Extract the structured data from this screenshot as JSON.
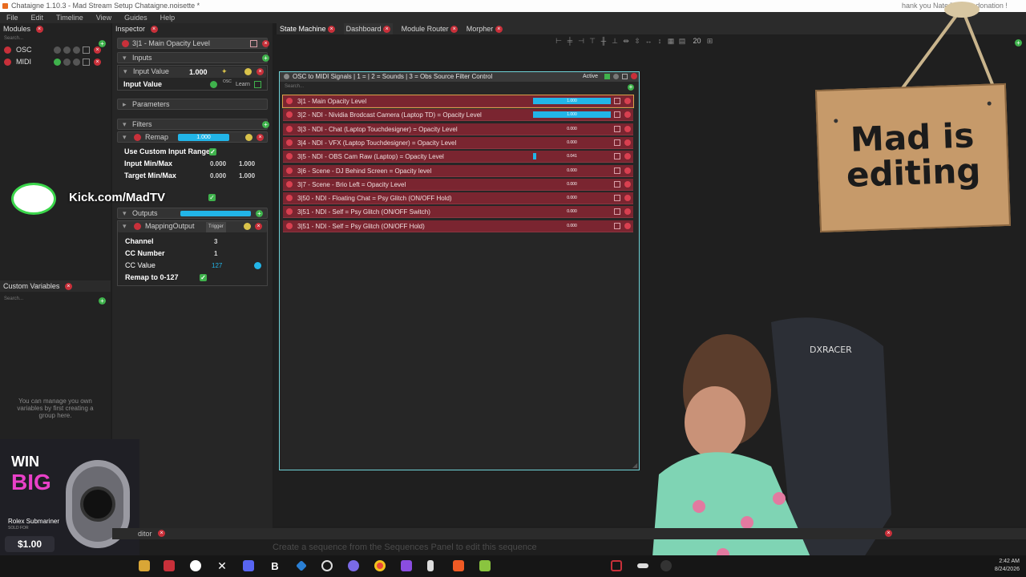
{
  "window": {
    "title": "Chataigne 1.10.3 - Mad Stream Setup Chataigne.noisette *",
    "donation_text": "hank you Nate Trav...e donation !"
  },
  "menu": [
    "File",
    "Edit",
    "Timeline",
    "View",
    "Guides",
    "Help"
  ],
  "modules_panel": {
    "title": "Modules",
    "search_placeholder": "Search...",
    "items": [
      {
        "name": "OSC"
      },
      {
        "name": "MIDI"
      }
    ]
  },
  "custom_vars_panel": {
    "title": "Custom Variables",
    "search_placeholder": "Search...",
    "hint": "You can manage you own variables by first creating a group here."
  },
  "inspector": {
    "title": "Inspector",
    "header": "3|1 - Main Opacity Level",
    "inputs_label": "Inputs",
    "input_value_label": "Input Value",
    "input_value": "1.000",
    "input_value2_label": "Input Value",
    "osc_label": "OSC",
    "learn_label": "Learn",
    "parameters_label": "Parameters",
    "filters_label": "Filters",
    "remap_label": "Remap",
    "remap_value": "1.000",
    "use_custom_range_label": "Use Custom Input Range",
    "input_minmax_label": "Input Min/Max",
    "input_min": "0.000",
    "input_max": "1.000",
    "target_minmax_label": "Target Min/Max",
    "target_min": "0.000",
    "target_max": "1.000",
    "outputs_label": "Outputs",
    "mapping_output_label": "MappingOutput",
    "trigger_label": "Trigger",
    "channel_label": "Channel",
    "channel_value": "3",
    "cc_number_label": "CC Number",
    "cc_number_value": "1",
    "cc_value_label": "CC Value",
    "cc_value": "127",
    "remap_0_127_label": "Remap to 0-127"
  },
  "tabs": [
    {
      "label": "State Machine"
    },
    {
      "label": "Dashboard"
    },
    {
      "label": "Module Router"
    },
    {
      "label": "Morpher"
    }
  ],
  "toolbar": {
    "zoom": "20"
  },
  "state_machine": {
    "title": "OSC to MIDI Signals | 1 =  | 2 = Sounds | 3 = Obs Source Filter Control",
    "active_label": "Active",
    "search_placeholder": "Search...",
    "rows": [
      {
        "label": "3|1 - Main Opacity Level",
        "value": "1.000",
        "level": 1.0
      },
      {
        "label": "3|2 - NDI - Nividia Brodcast Camera (Laptop TD) = Opacity Level",
        "value": "1.000",
        "level": 1.0
      },
      {
        "label": "3|3 - NDI - Chat (Laptop Touchdesigner) = Opacity Level",
        "value": "0.000",
        "level": 0.0
      },
      {
        "label": "3|4 - NDI - VFX (Laptop Touchdesigner) = Opacity Level",
        "value": "0.000",
        "level": 0.0
      },
      {
        "label": "3|5 - NDI - OBS Cam Raw (Laptop) = Opacity Level",
        "value": "0.041",
        "level": 0.041
      },
      {
        "label": "3|6 - Scene - DJ Behind Screen = Opacity level",
        "value": "0.000",
        "level": 0.0
      },
      {
        "label": "3|7 - Scene - Brio Left = Opacity Level",
        "value": "0.000",
        "level": 0.0
      },
      {
        "label": "3|50 - NDI - Floating Chat = Psy Glitch (ON/OFF Hold)",
        "value": "0.000",
        "level": 0.0
      },
      {
        "label": "3|51 - NDI - Self = Psy Glitch (ON/OFF Switch)",
        "value": "0.000",
        "level": 0.0
      },
      {
        "label": "3|51 - NDI - Self = Psy Glitch (ON/OFF Hold)",
        "value": "0.000",
        "level": 0.0
      }
    ]
  },
  "overlay": {
    "sign_line1": "Mad is",
    "sign_line2": "editing",
    "kick_text": "Kick.com/MadTV",
    "ad_win": "WIN",
    "ad_big": "BIG",
    "ad_product": "Rolex Submariner",
    "ad_sold_for": "SOLD FOR",
    "ad_price": "$1.00"
  },
  "bottom": {
    "sequence_editor_label": "ditor",
    "sequence_hint": "Create a sequence from the Sequences Panel to edit this sequence"
  },
  "taskbar": {
    "time": "2:42 AM",
    "date": "8/24/2026"
  },
  "colors": {
    "accent": "#22b5e8",
    "state_bg": "#7a2530",
    "frame": "#6fd3d8",
    "ok": "#3fb24c",
    "danger": "#c8303a"
  }
}
